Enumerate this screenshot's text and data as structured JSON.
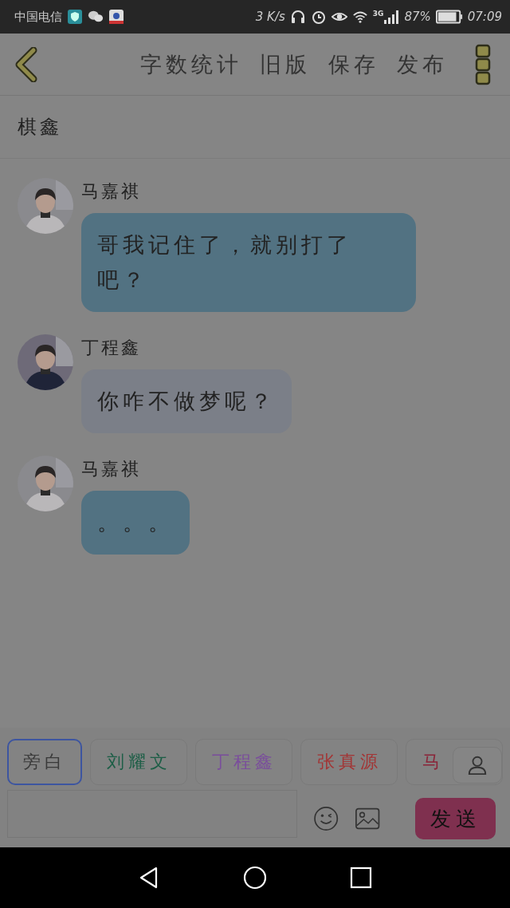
{
  "status_bar": {
    "carrier": "中国电信",
    "speed": "3 K/s",
    "network": "3G",
    "battery": "87%",
    "time": "07:09"
  },
  "toolbar": {
    "actions": [
      "字数统计",
      "旧版",
      "保存",
      "发布"
    ]
  },
  "title": "棋鑫",
  "messages": [
    {
      "sender": "马嘉祺",
      "text": "哥我记住了，就别打了吧？",
      "color": "#527282"
    },
    {
      "sender": "丁程鑫",
      "text": "你咋不做梦呢？",
      "color": "#7b7f88"
    },
    {
      "sender": "马嘉祺",
      "text": "。。。",
      "color": "#527282"
    }
  ],
  "roles": [
    {
      "label": "旁白",
      "color": "#3a3a3a",
      "selected": true
    },
    {
      "label": "刘耀文",
      "color": "#1c5e46",
      "selected": false
    },
    {
      "label": "丁程鑫",
      "color": "#7a4d9c",
      "selected": false
    },
    {
      "label": "张真源",
      "color": "#a33434",
      "selected": false
    },
    {
      "label": "马",
      "color": "#8a2438",
      "selected": false
    }
  ],
  "send_button": "发送"
}
